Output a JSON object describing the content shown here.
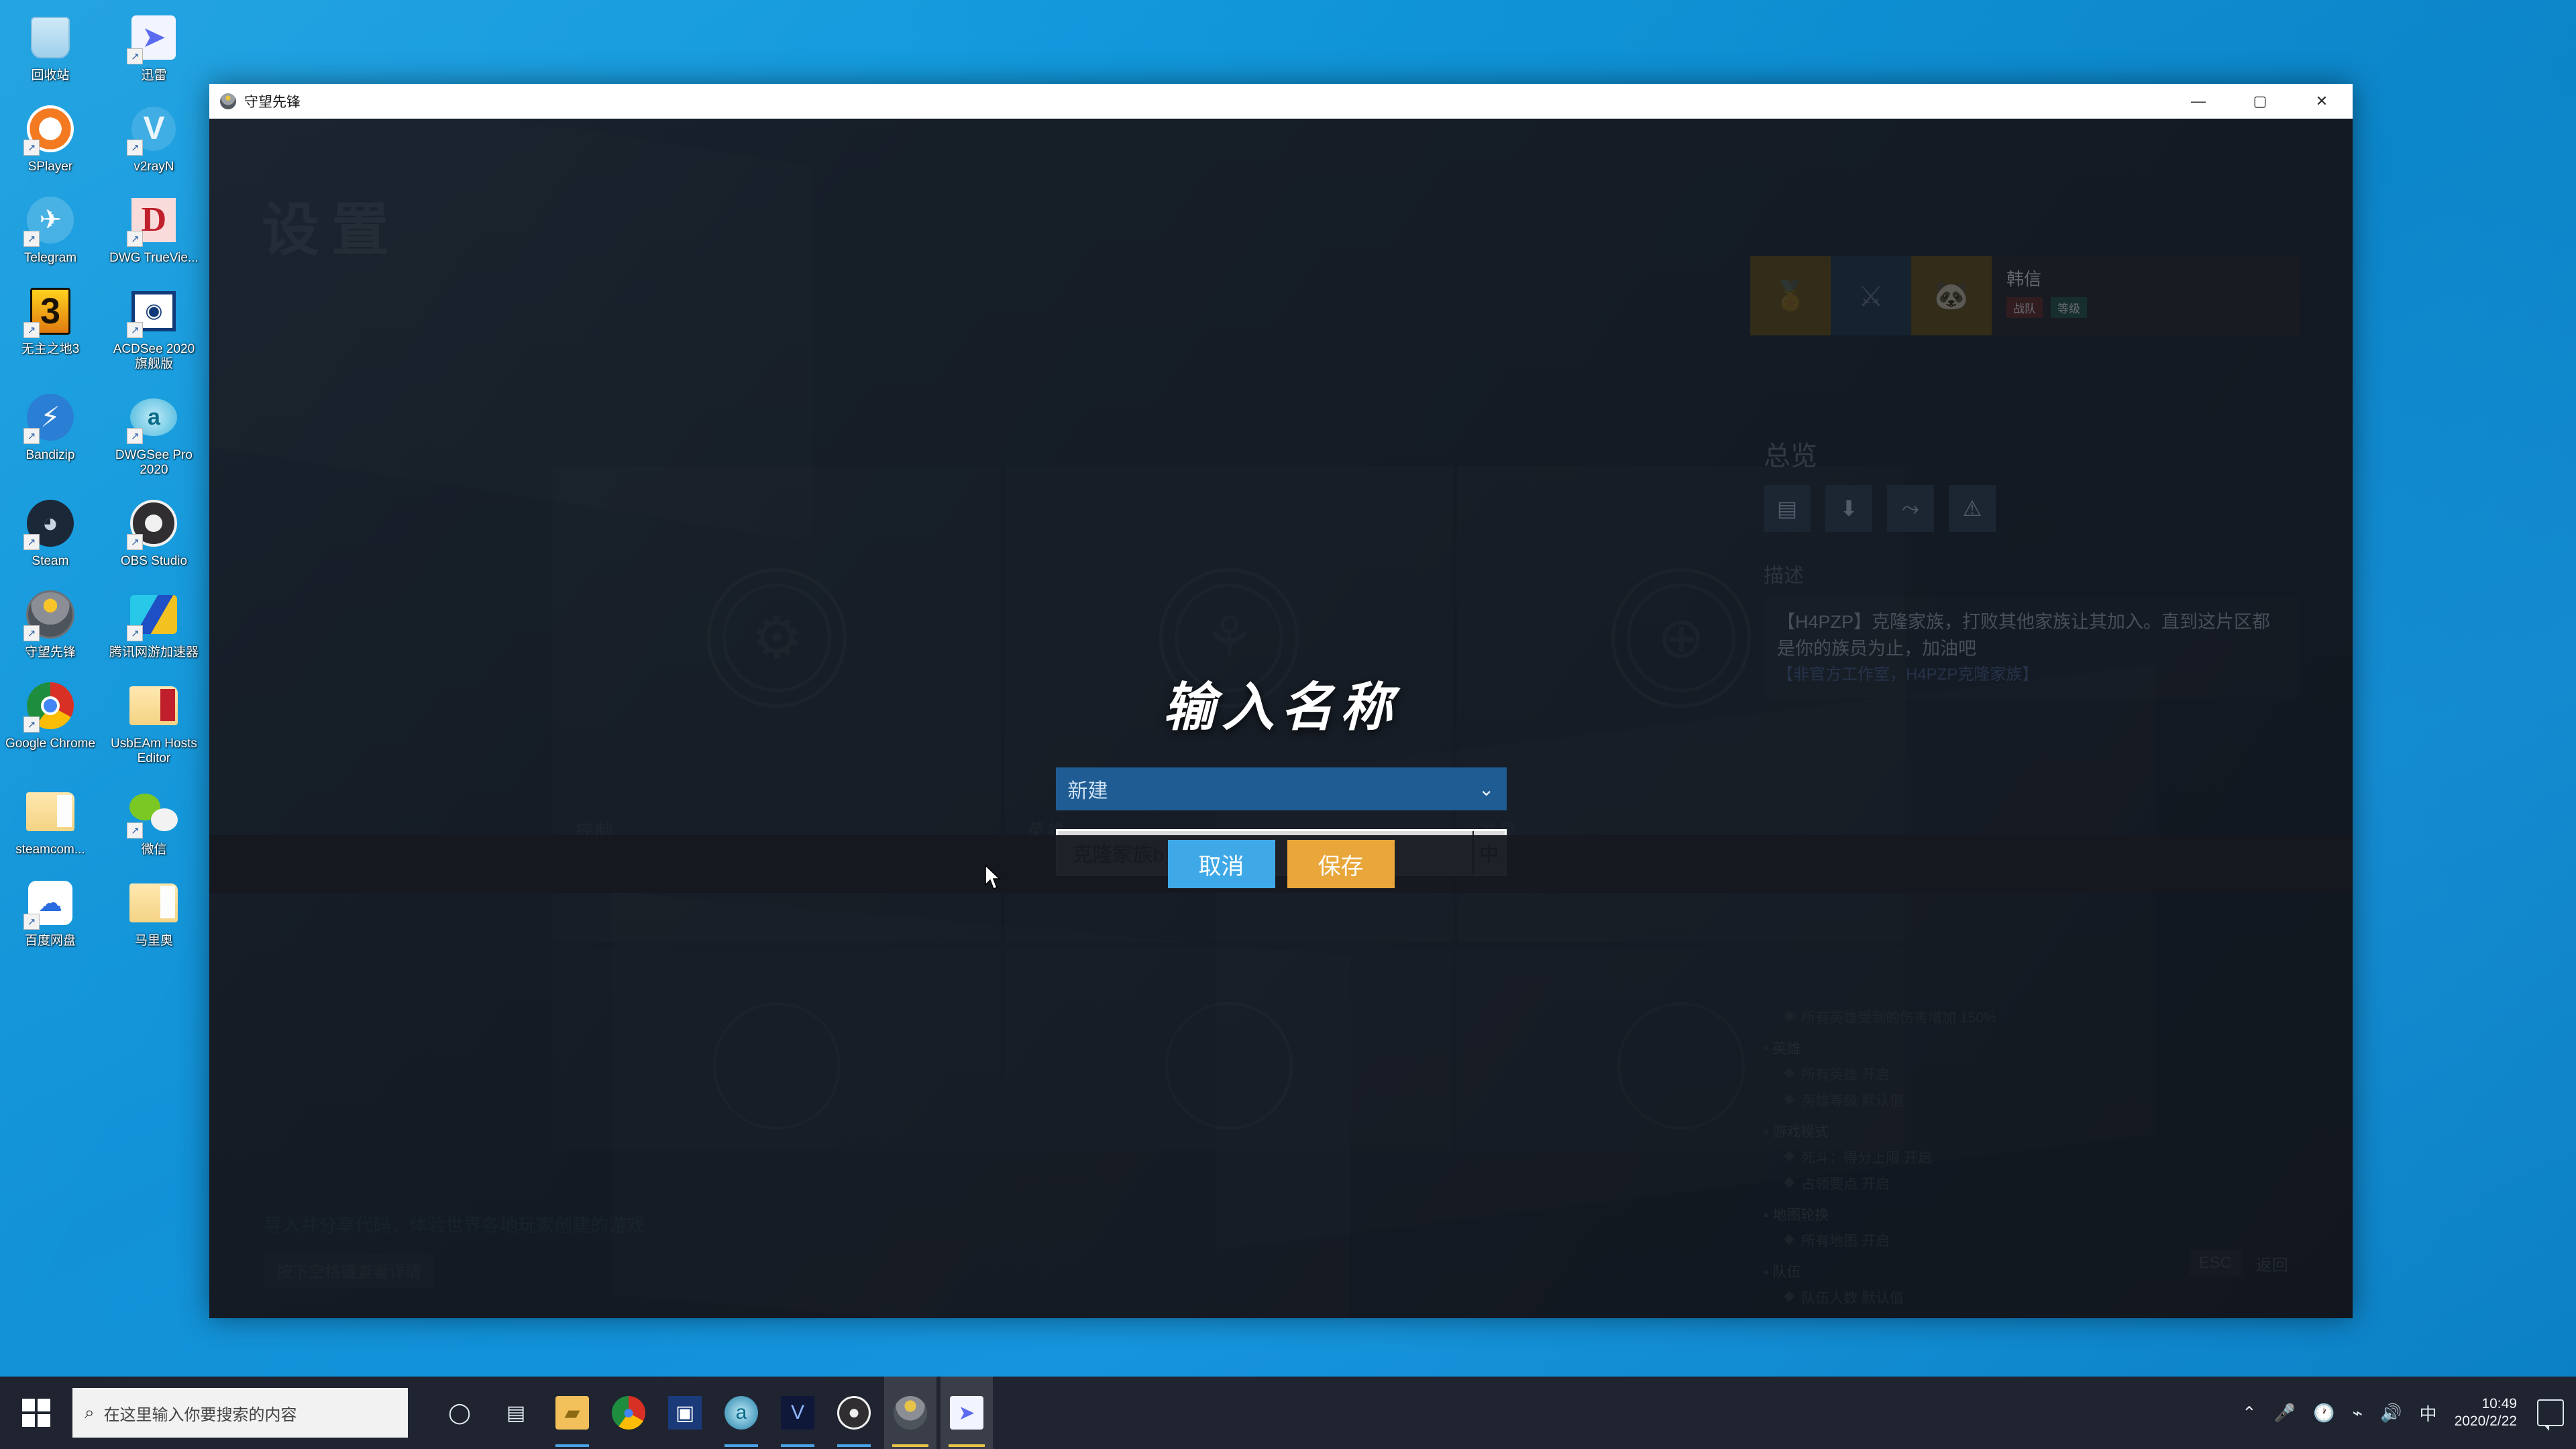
{
  "desktop": {
    "icons": [
      {
        "label": "回收站",
        "icon": "recycle-bin-icon",
        "shortcut": false
      },
      {
        "label": "迅雷",
        "icon": "thunder-download-icon",
        "shortcut": true
      },
      {
        "label": "SPlayer",
        "icon": "splayer-icon",
        "shortcut": true
      },
      {
        "label": "v2rayN",
        "icon": "v2rayn-icon",
        "shortcut": true
      },
      {
        "label": "Telegram",
        "icon": "telegram-icon",
        "shortcut": true
      },
      {
        "label": "DWG TrueVie...",
        "icon": "dwg-trueview-icon",
        "shortcut": true
      },
      {
        "label": "无主之地3",
        "icon": "borderlands3-icon",
        "shortcut": true
      },
      {
        "label": "ACDSee 2020 旗舰版",
        "icon": "acdsee-icon",
        "shortcut": true
      },
      {
        "label": "Bandizip",
        "icon": "bandizip-icon",
        "shortcut": true
      },
      {
        "label": "DWGSee Pro 2020",
        "icon": "dwgsee-icon",
        "shortcut": true
      },
      {
        "label": "Steam",
        "icon": "steam-icon",
        "shortcut": true
      },
      {
        "label": "OBS Studio",
        "icon": "obs-studio-icon",
        "shortcut": true
      },
      {
        "label": "守望先锋",
        "icon": "overwatch-icon",
        "shortcut": true
      },
      {
        "label": "腾讯网游加速器",
        "icon": "tencent-game-accelerator-icon",
        "shortcut": true
      },
      {
        "label": "Google Chrome",
        "icon": "chrome-icon",
        "shortcut": true
      },
      {
        "label": "UsbEAm Hosts Editor",
        "icon": "usbeam-hosts-editor-icon",
        "shortcut": false
      },
      {
        "label": "steamcom...",
        "icon": "folder-icon",
        "shortcut": false
      },
      {
        "label": "微信",
        "icon": "wechat-icon",
        "shortcut": true
      },
      {
        "label": "百度网盘",
        "icon": "baidu-netdisk-icon",
        "shortcut": true
      },
      {
        "label": "马里奥",
        "icon": "folder-icon",
        "shortcut": false
      }
    ]
  },
  "window": {
    "title": "守望先锋",
    "minimize_label": "—",
    "maximize_label": "▢",
    "close_label": "✕"
  },
  "game": {
    "settings_title": "设置",
    "profile": {
      "name": "韩信",
      "badges": [
        "战队",
        "等级"
      ],
      "tiles": [
        "medal-tile",
        "crossed-swords-tile",
        "panda-avatar-tile"
      ]
    },
    "cards": [
      {
        "emblem": "gear-circle-emblem",
        "label": "控制"
      },
      {
        "emblem": "hero-circle-emblem",
        "label": "英雄"
      },
      {
        "emblem": "crosshair-circle-emblem",
        "label": "准星"
      }
    ],
    "cards2": [
      {
        "emblem": "sound-circle-emblem"
      },
      {
        "emblem": "video-circle-emblem"
      },
      {
        "emblem": "gameplay-circle-emblem"
      }
    ],
    "right_panel": {
      "title": "总览",
      "actions": [
        "save-icon",
        "import-icon",
        "share-icon",
        "report-icon"
      ],
      "desc_label": "描述",
      "desc_text": "【H4PZP】克隆家族，打败其他家族让其加入。直到这片区都是你的族员为止，加油吧",
      "desc_sub": "【非官方工作室，H4PZP克隆家族】"
    },
    "tree": [
      {
        "type": "item",
        "text": "所有英雄受到的伤害增加 150%"
      },
      {
        "type": "group",
        "text": "英雄"
      },
      {
        "type": "item",
        "text": "所有英雄 开启"
      },
      {
        "type": "item",
        "text": "英雄等级 默认值"
      },
      {
        "type": "group",
        "text": "游戏模式"
      },
      {
        "type": "item",
        "text": "死斗：得分上限 开启"
      },
      {
        "type": "item",
        "text": "占领要点 开启"
      },
      {
        "type": "group",
        "text": "地图轮换"
      },
      {
        "type": "item",
        "text": "所有地图 开启"
      },
      {
        "type": "group",
        "text": "队伍"
      },
      {
        "type": "item",
        "text": "队伍人数 默认值"
      }
    ],
    "bottom_note": "导入并分享代码，体验世界各地玩家创建的游戏",
    "bottom_chip": "按下空格键查看详情",
    "esc_key": "ESC",
    "esc_label": "返回"
  },
  "modal": {
    "title": "输入名称",
    "select_value": "新建",
    "select_caret": "⌄",
    "input_value": "克隆家族b",
    "input_placeholder": "",
    "ime_indicator": "中",
    "cancel_label": "取消",
    "save_label": "保存"
  },
  "taskbar": {
    "start_name": "start-button",
    "search_placeholder": "在这里输入你要搜索的内容",
    "search_icon": "search-icon",
    "apps": [
      {
        "name": "cortana-icon",
        "glyph": "◯",
        "color": "#e8eef5",
        "bg": "transparent",
        "state": "idle"
      },
      {
        "name": "task-view-icon",
        "glyph": "▤",
        "color": "#e8eef5",
        "bg": "transparent",
        "state": "idle"
      },
      {
        "name": "file-explorer-icon",
        "glyph": "🗀",
        "color": "#f2c05a",
        "bg": "#f2c05a",
        "state": "running"
      },
      {
        "name": "chrome-icon",
        "glyph": "◉",
        "color": "#ffffff",
        "bg": "#d93025",
        "state": "idle"
      },
      {
        "name": "acdsee-icon",
        "glyph": "▣",
        "color": "#ffffff",
        "bg": "#1b3a7a",
        "state": "idle"
      },
      {
        "name": "dwgsee-icon",
        "glyph": "◈",
        "color": "#bfeaf7",
        "bg": "#1f7fa8",
        "state": "running"
      },
      {
        "name": "v2rayn-icon",
        "glyph": "V",
        "color": "#8fb7ff",
        "bg": "#10183a",
        "state": "running"
      },
      {
        "name": "obs-studio-icon",
        "glyph": "◎",
        "color": "#f0f0f0",
        "bg": "#302e31",
        "state": "running"
      },
      {
        "name": "overwatch-icon",
        "glyph": "◍",
        "color": "#e8c34a",
        "bg": "#4e545c",
        "state": "focused"
      },
      {
        "name": "thunder-download-icon",
        "glyph": "▌",
        "color": "#4a6bdd",
        "bg": "#f2f4ff",
        "state": "focused"
      }
    ],
    "tray": {
      "chevron": "⌃",
      "icons": [
        "microphone-icon",
        "clock-sync-icon",
        "wifi-icon",
        "volume-icon"
      ],
      "ime": "中",
      "time": "10:49",
      "date": "2020/2/22",
      "notification": "notification-icon"
    }
  }
}
